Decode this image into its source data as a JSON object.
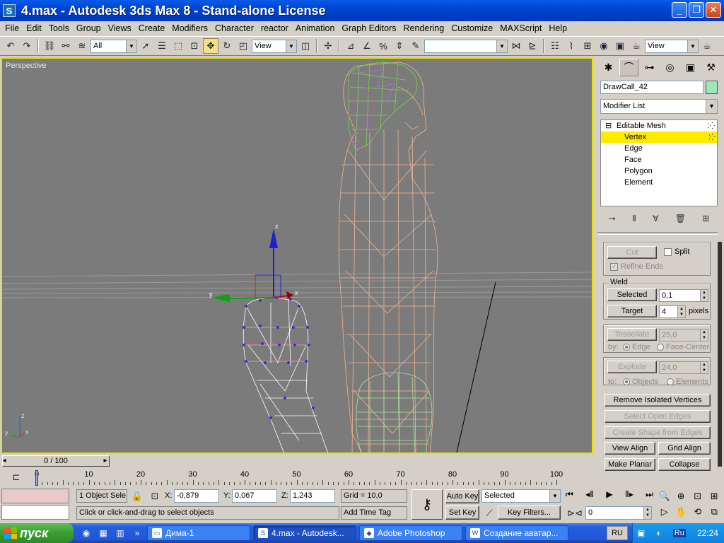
{
  "window": {
    "title": "4.max - Autodesk 3ds Max 8  - Stand-alone License",
    "app_icon": "S"
  },
  "menu": [
    "File",
    "Edit",
    "Tools",
    "Group",
    "Views",
    "Create",
    "Modifiers",
    "Character",
    "reactor",
    "Animation",
    "Graph Editors",
    "Rendering",
    "Customize",
    "MAXScript",
    "Help"
  ],
  "toolbar": {
    "selection_filter": "All",
    "ref_coord": "View",
    "named_sel": "",
    "ref_coord2": "View"
  },
  "viewport": {
    "label": "Perspective",
    "axis_z": "z",
    "axis_x": "x",
    "axis_y": "y",
    "border_color": "#e7e200"
  },
  "command_panel": {
    "object_name": "DrawCall_42",
    "object_color": "#9fe6ba",
    "modifier_list": "Modifier List",
    "stack": {
      "top": "Editable Mesh",
      "items": [
        "Vertex",
        "Edge",
        "Face",
        "Polygon",
        "Element"
      ],
      "selected_index": 0
    },
    "cut": "Cut",
    "split": "Split",
    "refine_ends": "Refine Ends",
    "weld": {
      "title": "Weld",
      "selected_label": "Selected",
      "selected_value": "0,1",
      "target_label": "Target",
      "target_value": "4",
      "pixels": "pixels"
    },
    "tessellate": {
      "label": "Tessellate",
      "value": "25,0",
      "by": "by:",
      "edge": "Edge",
      "face_center": "Face-Center"
    },
    "explode": {
      "label": "Explode",
      "value": "24,0",
      "to": "to:",
      "objects": "Objects",
      "elements": "Elements"
    },
    "remove_isolated": "Remove Isolated Vertices",
    "select_open_edges": "Select Open Edges",
    "create_shape": "Create Shape from Edges",
    "view_align": "View Align",
    "grid_align": "Grid Align",
    "make_planar": "Make Planar",
    "collapse": "Collapse"
  },
  "timeline": {
    "slider_label": "0 / 100",
    "ticks": [
      "0",
      "10",
      "20",
      "30",
      "40",
      "50",
      "60",
      "70",
      "80",
      "90",
      "100"
    ]
  },
  "status": {
    "selection": "1 Object Sele",
    "x_label": "X:",
    "x_value": "-0,879",
    "y_label": "Y:",
    "y_value": "0,067",
    "z_label": "Z:",
    "z_value": "1,243",
    "grid": "Grid = 10,0",
    "prompt": "Click or click-and-drag to select objects",
    "add_time_tag": "Add Time Tag",
    "auto_key": "Auto Key",
    "set_key": "Set Key",
    "key_mode": "Selected",
    "key_filters": "Key Filters...",
    "frame": "0"
  },
  "taskbar": {
    "start": "пуск",
    "tasks": [
      {
        "label": "Дима-1",
        "icon": "folder-icon"
      },
      {
        "label": "4.max - Autodesk...",
        "icon": "max-icon"
      },
      {
        "label": "Adobe Photoshop",
        "icon": "photoshop-icon"
      },
      {
        "label": "Создание аватар...",
        "icon": "word-icon"
      }
    ],
    "lang": "RU",
    "tray_lang": "Ru",
    "clock": "22:24"
  }
}
